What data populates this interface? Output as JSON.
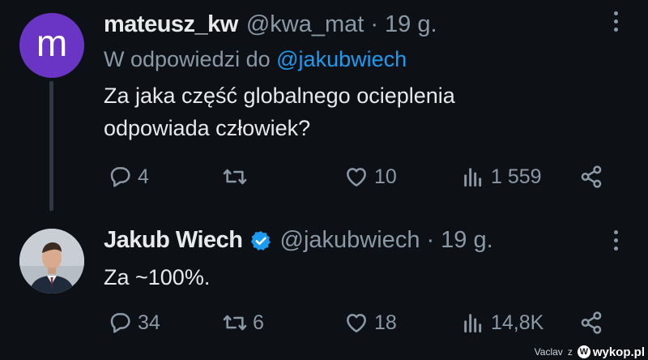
{
  "tweets": [
    {
      "avatar_letter": "m",
      "name": "mateusz_kw",
      "handle": "@kwa_mat",
      "separator": "·",
      "time": "19 g.",
      "reply_prefix": "W odpowiedzi do",
      "reply_mention": "@jakubwiech",
      "text": "Za jaka część globalnego ocieplenia odpowiada człowiek?",
      "actions": {
        "replies": "4",
        "retweets": "",
        "likes": "10",
        "views": "1 559"
      }
    },
    {
      "name": "Jakub Wiech",
      "handle": "@jakubwiech",
      "separator": "·",
      "time": "19 g.",
      "text": "Za ~100%.",
      "actions": {
        "replies": "34",
        "retweets": "6",
        "likes": "18",
        "views": "14,8K"
      }
    }
  ],
  "colors": {
    "background": "#0d1116",
    "accent": "#1d9bf0",
    "muted": "#8b98a5",
    "avatar1": "#6a35c4"
  },
  "icons": [
    "reply-icon",
    "retweet-icon",
    "like-icon",
    "views-icon",
    "share-icon",
    "more-icon",
    "verified-icon"
  ],
  "watermark": {
    "user": "Vaclav",
    "z": "z",
    "brand": "wykop.pl",
    "logo": "W"
  }
}
